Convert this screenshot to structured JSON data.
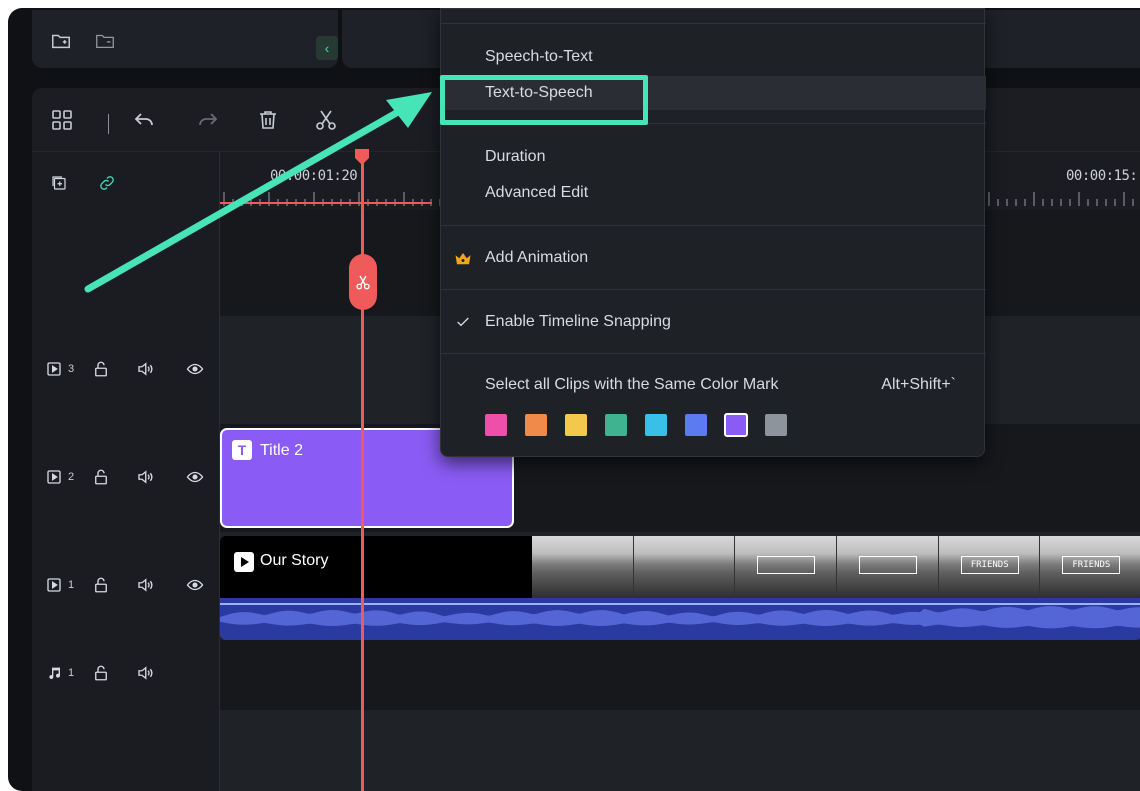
{
  "top_panel": {
    "icons": [
      "new-folder-icon",
      "folder-icon"
    ],
    "collapse_glyph": "‹"
  },
  "toolbar": {
    "icons": [
      "layout-icon",
      "undo-icon",
      "redo-icon",
      "delete-icon",
      "cut-icon"
    ]
  },
  "ruler": {
    "labels": [
      "00:00:01:20",
      "00:00:15:"
    ]
  },
  "tracks": [
    {
      "id": "v3",
      "type": "video",
      "number": "3"
    },
    {
      "id": "v2",
      "type": "video",
      "number": "2"
    },
    {
      "id": "v1",
      "type": "video",
      "number": "1"
    },
    {
      "id": "a1",
      "type": "audio",
      "number": "1"
    }
  ],
  "clips": {
    "title_clip": {
      "label": "Title 2",
      "color": "#8a5cf5"
    },
    "video_clip": {
      "label": "Our Story",
      "frame_text": "FRIENDS"
    }
  },
  "context_menu": {
    "items": [
      {
        "label": "Speech-to-Text"
      },
      {
        "label": "Text-to-Speech",
        "highlighted": true
      },
      {
        "label": "Duration"
      },
      {
        "label": "Advanced Edit"
      },
      {
        "label": "Add Animation",
        "icon": "crown-icon"
      },
      {
        "label": "Enable Timeline Snapping",
        "checked": true
      },
      {
        "label": "Select all Clips with the Same Color Mark",
        "shortcut": "Alt+Shift+`"
      }
    ],
    "color_marks": [
      "#ee4fa8",
      "#f08a4b",
      "#f2c94c",
      "#3fb38f",
      "#38c0e8",
      "#5d7bf0",
      "#8a5cf5",
      "#8e949b"
    ],
    "selected_color_index": 6
  },
  "annotation": {
    "highlight_color": "#47e4b8"
  }
}
